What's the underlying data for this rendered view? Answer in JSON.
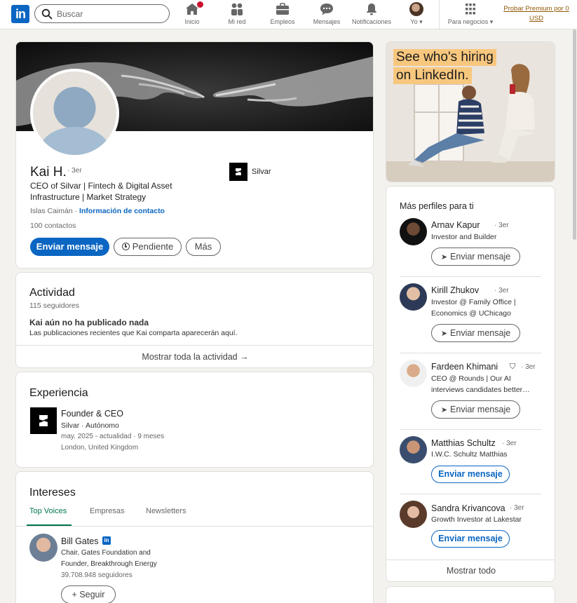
{
  "nav": {
    "search_placeholder": "Buscar",
    "items": [
      {
        "label": "Inicio",
        "icon": "home-icon"
      },
      {
        "label": "Mi red",
        "icon": "network-icon"
      },
      {
        "label": "Empleos",
        "icon": "briefcase-icon"
      },
      {
        "label": "Mensajes",
        "icon": "messaging-icon"
      },
      {
        "label": "Notificaciones",
        "icon": "bell-icon"
      },
      {
        "label": "Yo ▾",
        "icon": "me-avatar"
      },
      {
        "label": "Para negocios ▾",
        "icon": "grid-icon"
      }
    ],
    "premium_line1": "Probar Premium por 0",
    "premium_line2": "USD"
  },
  "profile": {
    "name": "Kai H.",
    "degree": "· 3er",
    "headline_line1": "CEO of Silvar | Fintech & Digital Asset",
    "headline_line2": "Infrastructure | Market Strategy",
    "location": "Islas Caimán",
    "location_sep": " · ",
    "contact_link": "Información de contacto",
    "connections": "100 contactos",
    "company": "Silvar",
    "btn_message": "Enviar mensaje",
    "btn_pending": "Pendiente",
    "btn_more": "Más"
  },
  "activity": {
    "title": "Actividad",
    "followers": "115 seguidores",
    "empty_title": "Kai aún no ha publicado nada",
    "empty_sub": "Las publicaciones recientes que Kai comparta aparecerán aquí.",
    "show_all": "Mostrar toda la actividad →"
  },
  "experience": {
    "title": "Experiencia",
    "role": "Founder & CEO",
    "company": "Silvar · Autónomo",
    "dates": "may. 2025 - actualidad · 9 meses",
    "location": "London, United Kingdom"
  },
  "interests": {
    "title": "Intereses",
    "tabs": [
      "Top Voices",
      "Empresas",
      "Newsletters"
    ],
    "person_name": "Bill Gates",
    "person_desc_line1": "Chair, Gates Foundation and",
    "person_desc_line2": "Founder, Breakthrough Energy",
    "person_followers": "39.708.948 seguidores",
    "follow_btn": "+ Seguir"
  },
  "ad": {
    "line1": "See who's hiring",
    "line2": "on LinkedIn."
  },
  "more_profiles": {
    "title": "Más perfiles para ti",
    "items": [
      {
        "name": "Arnav Kapur",
        "degree": "· 3er",
        "line1": "Investor and Builder",
        "line2": "",
        "btn": "Enviar mensaje",
        "btn_style": "outline"
      },
      {
        "name": "Kirill Zhukov",
        "degree": "· 3er",
        "line1": "Investor @ Family Office |",
        "line2": "Economics @ UChicago",
        "btn": "Enviar mensaje",
        "btn_style": "outline"
      },
      {
        "name": "Fardeen Khimani",
        "degree": "· 3er",
        "line1": "CEO @ Rounds | Our AI",
        "line2": "interviews candidates better…",
        "btn": "Enviar mensaje",
        "btn_style": "outline"
      },
      {
        "name": "Matthias Schultz",
        "degree": "· 3er",
        "line1": "I.W.C. Schultz Matthias",
        "line2": "",
        "btn": "Enviar mensaje",
        "btn_style": "blue"
      },
      {
        "name": "Sandra Krivancova",
        "degree": "· 3er",
        "line1": "Growth Investor at Lakestar",
        "line2": "",
        "btn": "Enviar mensaje",
        "btn_style": "blue"
      }
    ],
    "show_all": "Mostrar todo"
  },
  "colors": {
    "brand": "#0a66c2",
    "premium": "#915907",
    "notification": "#cb112d",
    "interest_tab_active": "#01754f"
  }
}
